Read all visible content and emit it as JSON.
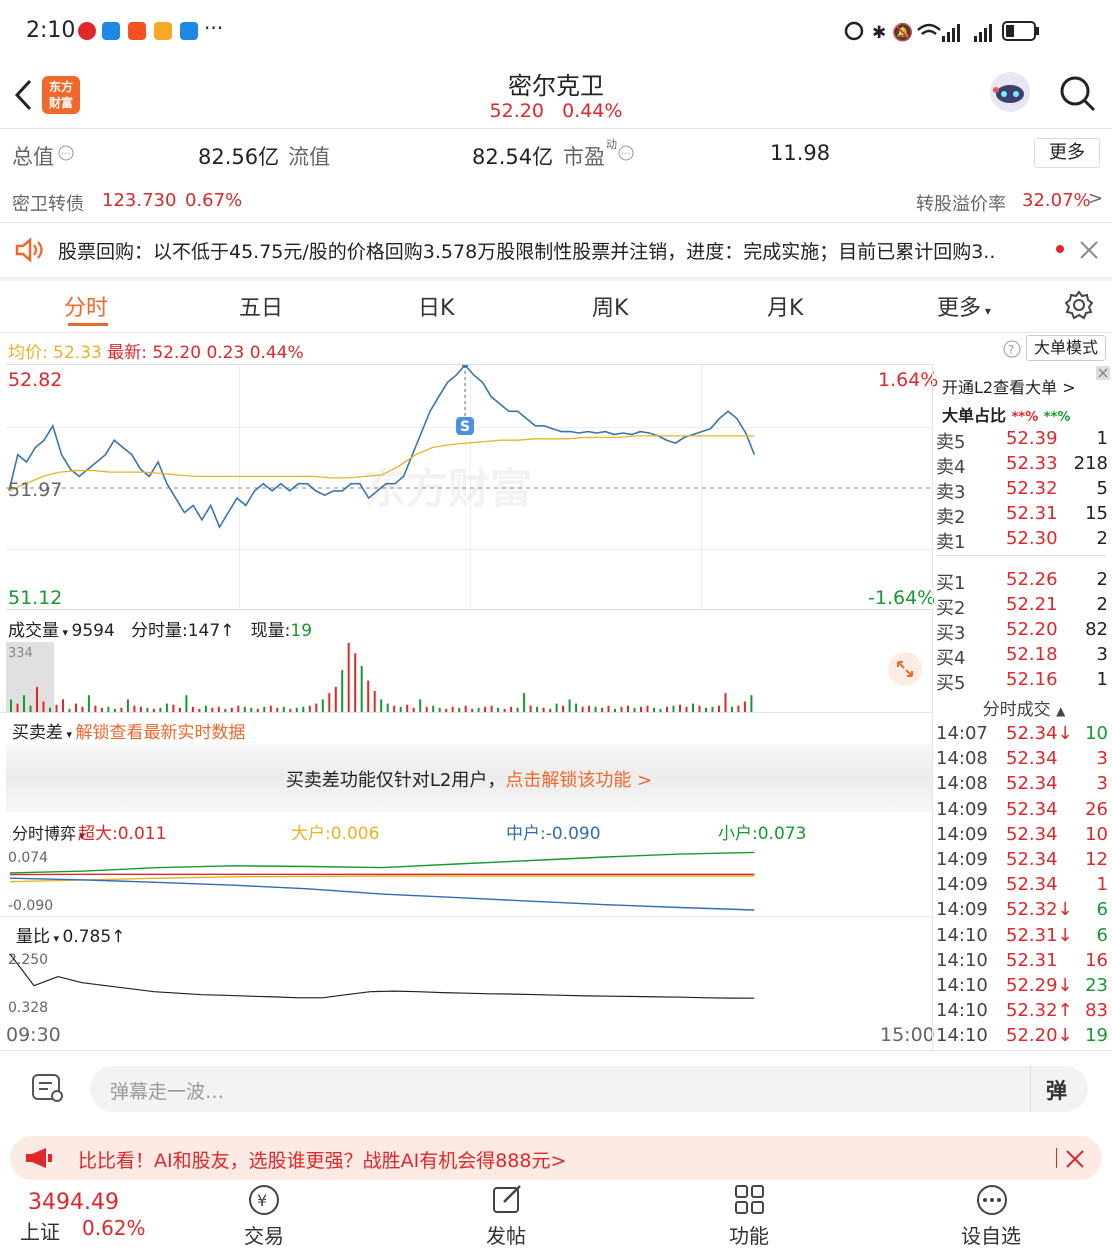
{
  "status": {
    "time": "2:10",
    "more": "···"
  },
  "header": {
    "logo_text": "东方\n财富",
    "title": "密尔克卫",
    "price": "52.20",
    "change_pct": "0.44%"
  },
  "quote": {
    "total_value_label": "总值",
    "total_value": "82.56亿",
    "float_value_label": "流值",
    "float_value": "82.54亿",
    "pe_label": "市盈",
    "pe_sup": "动",
    "pe_value": "11.98",
    "more_button": "更多",
    "bond_label": "密卫转债",
    "bond_price": "123.730",
    "bond_pct": "0.67%",
    "premium_label": "转股溢价率",
    "premium_value": "32.07%"
  },
  "notice": {
    "text": "股票回购：以不低于45.75元/股的价格回购3.578万股限制性股票并注销，进度：完成实施；目前已累计回购3.."
  },
  "tabs": [
    "分时",
    "五日",
    "日K",
    "周K",
    "月K",
    "更多"
  ],
  "chart_info": {
    "avg_label": "均价:",
    "avg_value": "52.33",
    "latest_label": "最新:",
    "latest_value": "52.20",
    "latest_change": "0.23",
    "latest_pct": "0.44%",
    "big_order_mode": "大单模式",
    "y_high": "52.82",
    "y_mid": "51.97",
    "y_low": "51.12",
    "pct_high": "1.64%",
    "pct_low": "-1.64%",
    "watermark": "东方财富",
    "marker": "S"
  },
  "volume": {
    "label": "成交量",
    "total": "9594",
    "minute_label": "分时量:",
    "minute_value": "147↑",
    "current_label": "现量:",
    "current_value": "19",
    "axis_max": "334"
  },
  "bid_ask_diff": {
    "label": "买卖差",
    "unlock_link": "解锁查看最新实时数据",
    "message": "买卖差功能仅针对L2用户，",
    "message_link": "点击解锁该功能 >"
  },
  "game": {
    "label": "分时博弈",
    "super_label": "超大:0.011",
    "big_label": "大户:0.006",
    "mid_label": "中户:-0.090",
    "small_label": "小户:0.073",
    "axis_max": "0.074",
    "axis_min": "-0.090"
  },
  "volume_ratio": {
    "label": "量比",
    "value": "0.785↑",
    "axis_max": "2.250",
    "axis_min": "0.328"
  },
  "time_axis": {
    "start": "09:30",
    "end": "15:00"
  },
  "side_panel": {
    "l2_link": "开通L2查看大单",
    "ratio_label": "大单占比",
    "ratio_red": "**%",
    "ratio_green": "**%",
    "sells": [
      {
        "label": "卖5",
        "price": "52.39",
        "vol": "1"
      },
      {
        "label": "卖4",
        "price": "52.33",
        "vol": "218"
      },
      {
        "label": "卖3",
        "price": "52.32",
        "vol": "5"
      },
      {
        "label": "卖2",
        "price": "52.31",
        "vol": "15"
      },
      {
        "label": "卖1",
        "price": "52.30",
        "vol": "2"
      }
    ],
    "buys": [
      {
        "label": "买1",
        "price": "52.26",
        "vol": "2"
      },
      {
        "label": "买2",
        "price": "52.21",
        "vol": "2"
      },
      {
        "label": "买3",
        "price": "52.20",
        "vol": "82"
      },
      {
        "label": "买4",
        "price": "52.18",
        "vol": "3"
      },
      {
        "label": "买5",
        "price": "52.16",
        "vol": "1"
      }
    ],
    "ticks_label": "分时成交",
    "ticks": [
      {
        "time": "14:07",
        "price": "52.34↓",
        "vol": "10"
      },
      {
        "time": "14:08",
        "price": "52.34",
        "vol": "3"
      },
      {
        "time": "14:08",
        "price": "52.34",
        "vol": "3"
      },
      {
        "time": "14:09",
        "price": "52.34",
        "vol": "26"
      },
      {
        "time": "14:09",
        "price": "52.34",
        "vol": "10"
      },
      {
        "time": "14:09",
        "price": "52.34",
        "vol": "12"
      },
      {
        "time": "14:09",
        "price": "52.34",
        "vol": "1"
      },
      {
        "time": "14:09",
        "price": "52.32↓",
        "vol": "6"
      },
      {
        "time": "14:10",
        "price": "52.31↓",
        "vol": "6"
      },
      {
        "time": "14:10",
        "price": "52.31",
        "vol": "16"
      },
      {
        "time": "14:10",
        "price": "52.29↓",
        "vol": "23"
      },
      {
        "time": "14:10",
        "price": "52.32↑",
        "vol": "83"
      },
      {
        "time": "14:10",
        "price": "52.20↓",
        "vol": "19"
      }
    ]
  },
  "comment": {
    "placeholder": "弹幕走一波…",
    "danmu_icon": "弹"
  },
  "promo": {
    "text": "比比看！AI和股友，选股谁更强？战胜AI有机会得888元>"
  },
  "bottom": {
    "index_value": "3494.49",
    "index_name": "上证",
    "index_pct": "0.62%",
    "nav": [
      "交易",
      "发帖",
      "功能",
      "设自选"
    ]
  },
  "colors": {
    "up": "#e0272c",
    "down": "#149a31",
    "price_line": "#3a74b2",
    "avg_line": "#e9b227",
    "accent": "#f0682b"
  },
  "chart_data": [
    {
      "type": "line",
      "name": "intraday",
      "x_range": [
        "09:30",
        "15:00"
      ],
      "ylim": [
        51.12,
        52.82
      ],
      "prev_close": 51.97,
      "series": [
        {
          "values": [
            51.95,
            52.2,
            52.15,
            52.25,
            52.3,
            52.4,
            52.2,
            52.1,
            52.05,
            52.1,
            52.15,
            52.2,
            52.3,
            52.25,
            52.2,
            52.1,
            52.05,
            52.15,
            52.0,
            51.9,
            51.8,
            51.85,
            51.75,
            51.85,
            51.7,
            51.8,
            51.9,
            51.85,
            51.95,
            52.0,
            51.95,
            52.0,
            51.95,
            52.0,
            52.0,
            51.95,
            51.92,
            51.95,
            51.95,
            52.0,
            52.0,
            51.9,
            51.95,
            52.0,
            52.0,
            52.05,
            52.2,
            52.35,
            52.5,
            52.6,
            52.7,
            52.75,
            52.82,
            52.75,
            52.7,
            52.6,
            52.55,
            52.5,
            52.5,
            52.45,
            52.4,
            52.4,
            52.38,
            52.36,
            52.36,
            52.35,
            52.36,
            52.35,
            52.36,
            52.34,
            52.35,
            52.34,
            52.36,
            52.35,
            52.33,
            52.3,
            52.28,
            52.32,
            52.34,
            52.36,
            52.38,
            52.45,
            52.5,
            52.45,
            52.35,
            52.2
          ]
        },
        {
          "values": [
            51.95,
            52.0,
            52.05,
            52.08,
            52.09,
            52.09,
            52.08,
            52.08,
            52.08,
            52.07,
            52.06,
            52.05,
            52.05,
            52.05,
            52.05,
            52.05,
            52.05,
            52.05,
            52.05,
            52.04,
            52.04,
            52.05,
            52.06,
            52.12,
            52.2,
            52.25,
            52.27,
            52.28,
            52.29,
            52.3,
            52.3,
            52.31,
            52.31,
            52.31,
            52.32,
            52.32,
            52.32,
            52.33,
            52.33,
            52.33,
            52.33,
            52.33,
            52.33,
            52.33,
            52.33
          ]
        }
      ]
    },
    {
      "type": "bar",
      "name": "minute_volume",
      "ylim": [
        0,
        334
      ],
      "values": [
        60,
        40,
        80,
        30,
        120,
        50,
        20,
        35,
        60,
        15,
        40,
        25,
        80,
        30,
        20,
        25,
        15,
        20,
        60,
        30,
        25,
        20,
        15,
        20,
        40,
        35,
        20,
        80,
        25,
        15,
        30,
        20,
        25,
        15,
        20,
        30,
        25,
        20,
        15,
        25,
        30,
        20,
        25,
        15,
        20,
        25,
        30,
        40,
        60,
        90,
        120,
        200,
        330,
        280,
        220,
        150,
        100,
        60,
        40,
        30,
        25,
        35,
        20,
        60,
        25,
        30,
        20,
        15,
        25,
        20,
        30,
        15,
        20,
        25,
        30,
        20,
        15,
        25,
        20,
        90,
        30,
        25,
        20,
        15,
        40,
        30,
        60,
        40,
        25,
        30,
        25,
        20,
        30,
        15,
        25,
        30,
        20,
        25,
        30,
        20,
        15,
        25,
        30,
        35,
        25,
        40,
        30,
        20,
        25,
        30,
        90,
        25,
        30,
        50,
        80
      ]
    },
    {
      "type": "line",
      "name": "game",
      "ylim": [
        -0.09,
        0.074
      ],
      "series": [
        {
          "name": "超大:0.011",
          "values": [
            0.01,
            0.011,
            0.011,
            0.011,
            0.011,
            0.011,
            0.011,
            0.011,
            0.011,
            0.011,
            0.011
          ]
        },
        {
          "name": "大户:0.006",
          "values": [
            -0.01,
            -0.005,
            0.0,
            0.004,
            0.005,
            0.006,
            0.006,
            0.006,
            0.006,
            0.006,
            0.006
          ]
        },
        {
          "name": "中户:-0.090",
          "values": [
            0.0,
            -0.005,
            -0.012,
            -0.02,
            -0.03,
            -0.045,
            -0.055,
            -0.065,
            -0.075,
            -0.083,
            -0.09
          ]
        },
        {
          "name": "小户:0.073",
          "values": [
            0.015,
            0.02,
            0.03,
            0.035,
            0.033,
            0.03,
            0.04,
            0.05,
            0.06,
            0.068,
            0.073
          ]
        }
      ]
    },
    {
      "type": "line",
      "name": "volume_ratio",
      "ylim": [
        0.328,
        2.25
      ],
      "values": [
        2.25,
        1.2,
        1.5,
        1.3,
        1.2,
        1.1,
        1.0,
        0.95,
        0.9,
        0.88,
        0.85,
        0.83,
        0.8,
        0.8,
        0.9,
        1.0,
        1.02,
        1.0,
        0.97,
        0.95,
        0.93,
        0.92,
        0.9,
        0.88,
        0.86,
        0.85,
        0.84,
        0.83,
        0.82,
        0.8,
        0.79,
        0.785
      ]
    }
  ]
}
